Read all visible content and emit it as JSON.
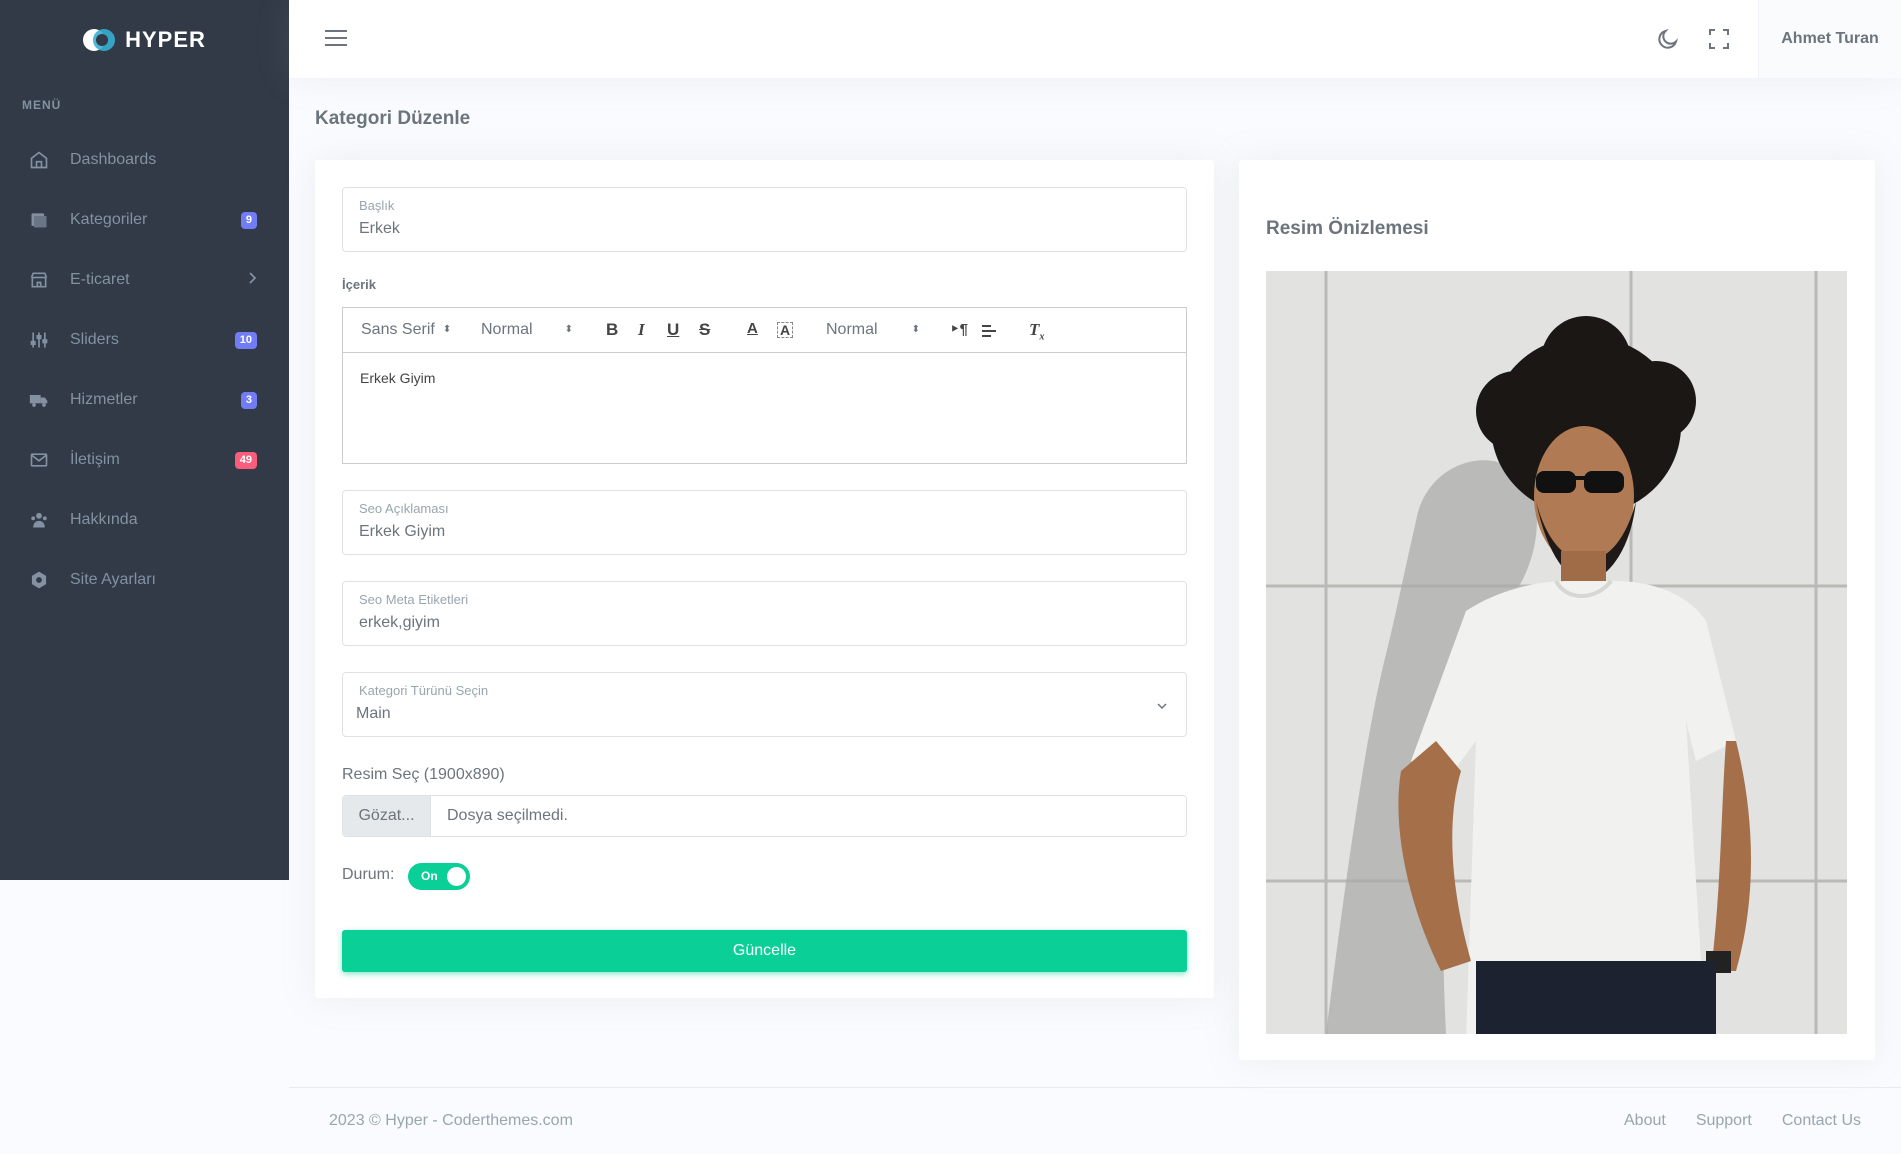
{
  "brand": {
    "name": "HYPER"
  },
  "sidebar": {
    "menu_title": "MENÜ",
    "items": [
      {
        "label": "Dashboards",
        "badge": null
      },
      {
        "label": "Kategoriler",
        "badge": "9"
      },
      {
        "label": "E-ticaret",
        "badge": null
      },
      {
        "label": "Sliders",
        "badge": "10"
      },
      {
        "label": "Hizmetler",
        "badge": "3"
      },
      {
        "label": "İletişim",
        "badge": "49"
      },
      {
        "label": "Hakkında",
        "badge": null
      },
      {
        "label": "Site Ayarları",
        "badge": null
      }
    ]
  },
  "topbar": {
    "user_name": "Ahmet Turan"
  },
  "page": {
    "title": "Kategori Düzenle"
  },
  "form": {
    "baslik": {
      "label": "Başlık",
      "value": "Erkek"
    },
    "icerik_label": "İçerik",
    "editor": {
      "font": "Sans Serif",
      "size": "Normal",
      "header": "Normal",
      "content": "Erkek Giyim"
    },
    "seo_aciklama": {
      "label": "Seo Açıklaması",
      "value": "Erkek Giyim"
    },
    "seo_meta": {
      "label": "Seo Meta Etiketleri",
      "value": "erkek,giyim"
    },
    "kategori_turu": {
      "label": "Kategori Türünü Seçin",
      "value": "Main"
    },
    "file": {
      "label": "Resim Seç (1900x890)",
      "button": "Gözat...",
      "status": "Dosya seçilmedi."
    },
    "durum": {
      "label": "Durum:",
      "toggle_text": "On",
      "enabled": true
    },
    "submit_label": "Güncelle"
  },
  "preview": {
    "title": "Resim Önizlemesi"
  },
  "footer": {
    "copyright": "2023 © Hyper - Coderthemes.com",
    "links": [
      "About",
      "Support",
      "Contact Us"
    ]
  },
  "colors": {
    "sidebar_bg": "#313a46",
    "success": "#0acf97",
    "badge_primary": "#727cf5",
    "badge_danger": "#fa5c7c"
  }
}
